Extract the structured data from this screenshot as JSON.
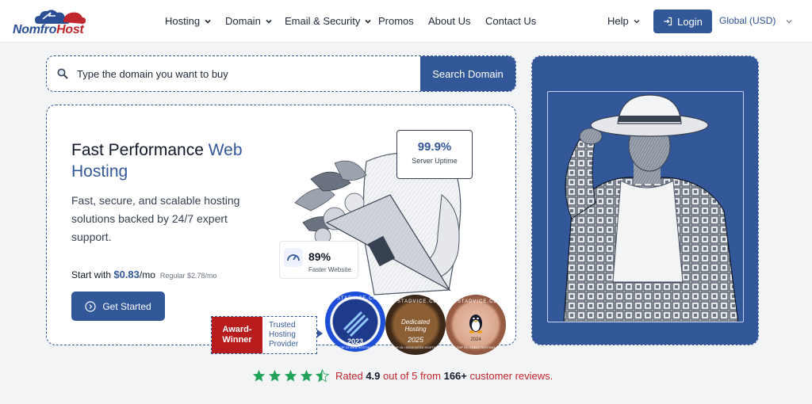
{
  "brand": {
    "logo_prefix": "Nomfro",
    "logo_suffix": "Host"
  },
  "nav": {
    "items": [
      {
        "label": "Hosting",
        "dropdown": true
      },
      {
        "label": "Domain",
        "dropdown": true
      },
      {
        "label": "Email & Security",
        "dropdown": true
      },
      {
        "label": "Promos",
        "dropdown": false
      },
      {
        "label": "About Us",
        "dropdown": false
      },
      {
        "label": "Contact Us",
        "dropdown": false
      }
    ],
    "help": "Help",
    "login": "Login",
    "currency": "Global (USD)"
  },
  "search": {
    "placeholder": "Type the domain you want to buy",
    "button": "Search Domain"
  },
  "hero": {
    "title_plain": "Fast Performance ",
    "title_accent": "Web Hosting",
    "subtitle": "Fast, secure, and scalable hosting solutions backed by 24/7 expert support.",
    "price_prefix": "Start with ",
    "price": "$0.83",
    "price_unit": "/mo",
    "regular": "Regular $2.78/mo",
    "cta": "Get Started"
  },
  "stats": {
    "uptime_value": "99.9%",
    "uptime_label": "Server Uptime",
    "speed_value": "89%",
    "speed_label": "Faster Website"
  },
  "award": {
    "red_label": "Award-Winner",
    "text": "Trusted Hosting Provider"
  },
  "badges": [
    {
      "site": "HOSTADVICE.COM",
      "year": "2023",
      "caption": "TOP 10 WEB HOSTING"
    },
    {
      "site": "HOSTADVICE.COM",
      "title": "Dedicated Hosting",
      "year": "2025",
      "caption": "TOP 25 • DEDICATED HOSTING"
    },
    {
      "site": "HOSTADVICE.COM",
      "year": "2024",
      "caption": "TOP 25 • LINUX HOSTING"
    }
  ],
  "rating": {
    "prefix": "Rated ",
    "score": "4.9",
    "middle": " out of 5 from ",
    "count": "166+",
    "suffix": " customer reviews.",
    "stars": 4.5
  },
  "colors": {
    "primary": "#33589a",
    "accent_red": "#c0272d",
    "star_green": "#22a35a",
    "page_bg": "#f3f4f6"
  }
}
